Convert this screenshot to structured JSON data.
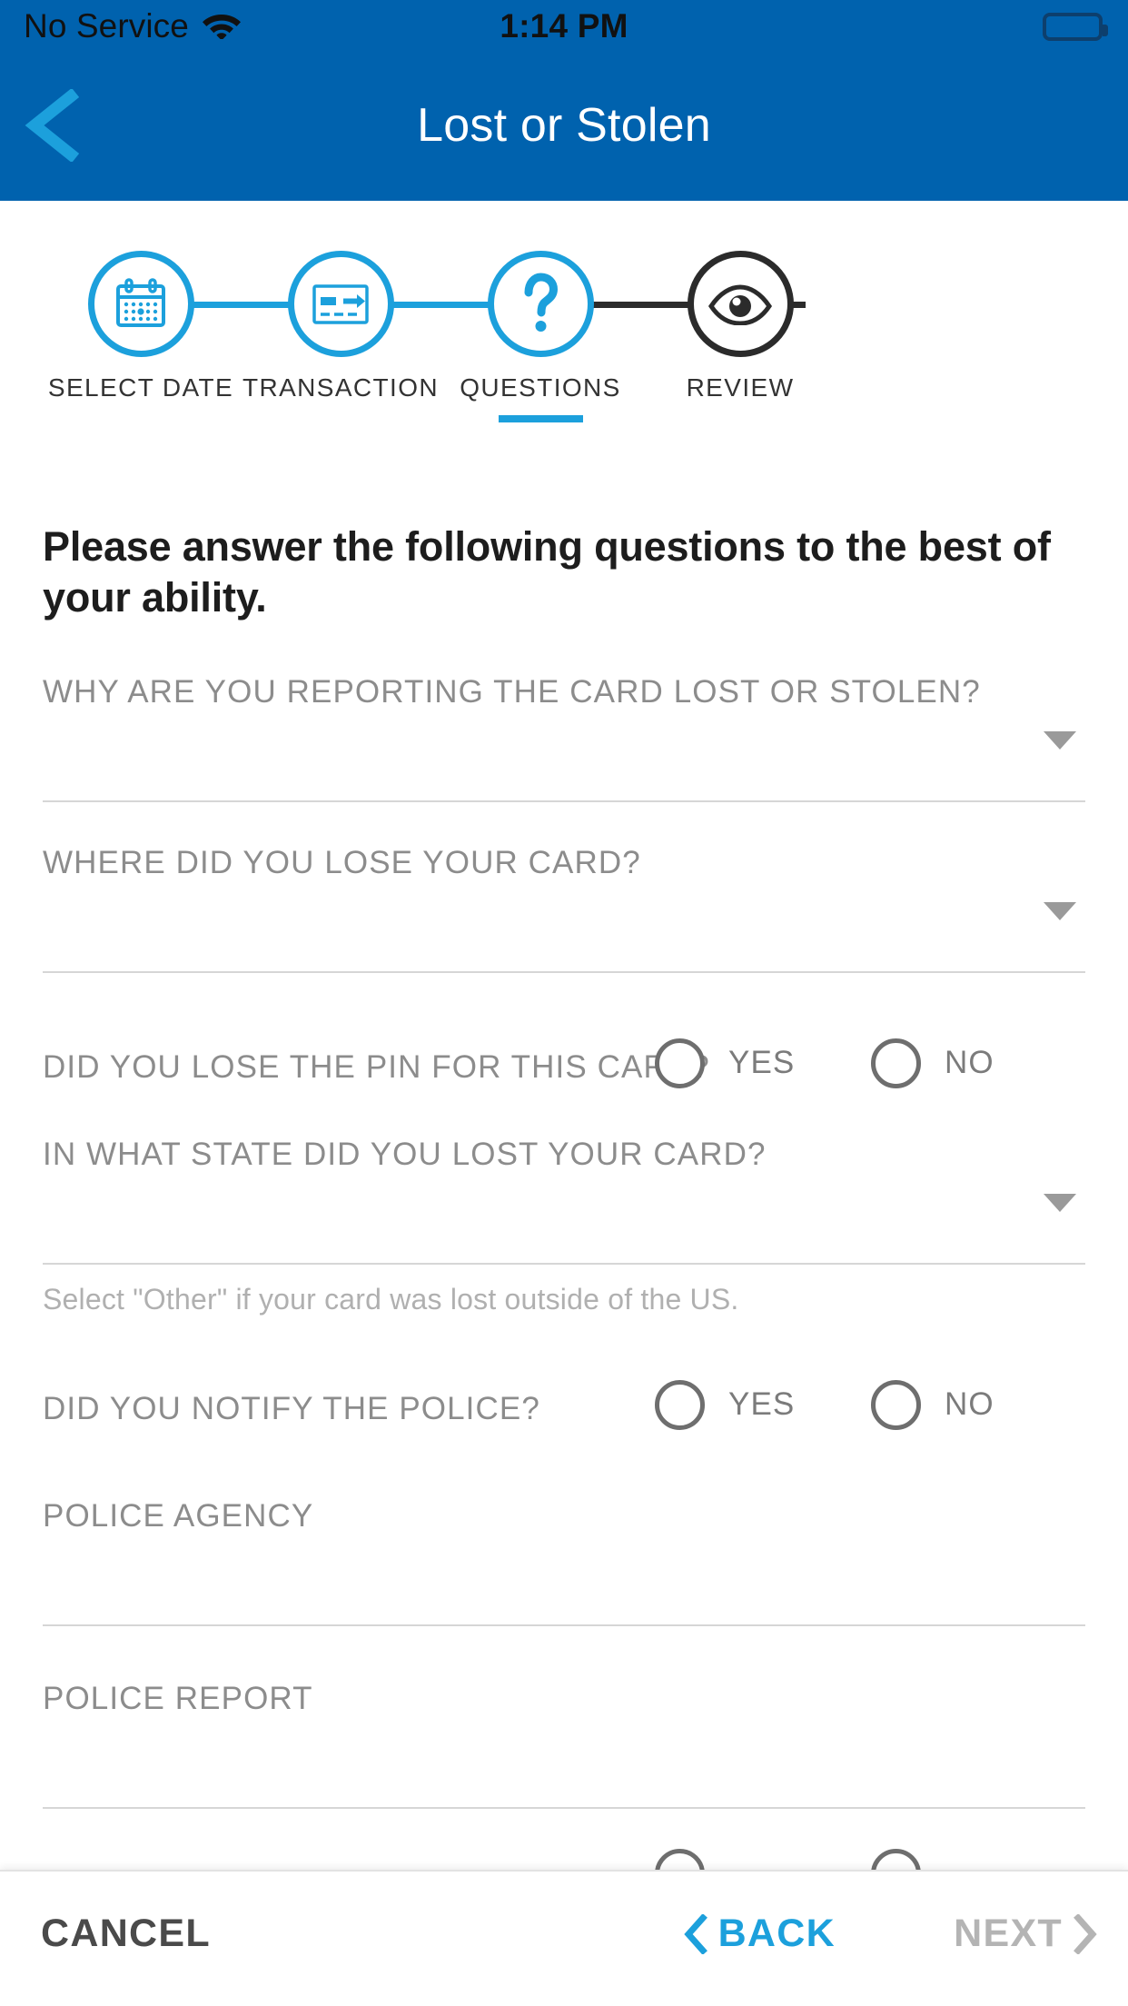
{
  "status_bar": {
    "carrier": "No Service",
    "wifi_icon": "wifi-icon",
    "time": "1:14 PM",
    "battery_icon": "battery-full-icon"
  },
  "nav": {
    "back_icon": "chevron-left-icon",
    "title": "Lost or Stolen"
  },
  "colors": {
    "header_blue": "#0062AE",
    "accent_blue": "#1CA0DC",
    "inactive_dark": "#2B2B2B",
    "label_gray": "#8C8C8C",
    "line_gray": "#D6D6D6",
    "helper_gray": "#B0B0B0",
    "disabled_gray": "#B4B4B4"
  },
  "stepper": {
    "steps": [
      {
        "label": "SELECT DATE",
        "icon": "calendar-icon",
        "state": "complete"
      },
      {
        "label": "TRANSACTION",
        "icon": "card-transfer-icon",
        "state": "complete"
      },
      {
        "label": "QUESTIONS",
        "icon": "question-mark-icon",
        "state": "active"
      },
      {
        "label": "REVIEW",
        "icon": "eye-icon",
        "state": "inactive"
      }
    ]
  },
  "main": {
    "heading": "Please answer the following questions to the best of your ability.",
    "fields": [
      {
        "label": "WHY ARE YOU REPORTING THE CARD LOST OR STOLEN?",
        "type": "dropdown",
        "value": ""
      },
      {
        "label": "WHERE DID YOU LOSE YOUR CARD?",
        "type": "dropdown",
        "value": ""
      },
      {
        "label": "DID YOU LOSE THE PIN FOR THIS CARD?",
        "type": "radio",
        "options": [
          "YES",
          "NO"
        ],
        "selected": ""
      },
      {
        "label": "IN WHAT STATE DID YOU LOST YOUR CARD?",
        "type": "dropdown",
        "value": "",
        "helper": "Select \"Other\" if your card was lost outside of the US."
      },
      {
        "label": "DID YOU NOTIFY THE POLICE?",
        "type": "radio",
        "options": [
          "YES",
          "NO"
        ],
        "selected": ""
      },
      {
        "label": "POLICE AGENCY",
        "type": "text",
        "value": ""
      },
      {
        "label": "POLICE REPORT",
        "type": "text",
        "value": ""
      }
    ]
  },
  "footer": {
    "cancel_label": "CANCEL",
    "back_label": "BACK",
    "back_icon": "chevron-left-icon",
    "next_label": "NEXT",
    "next_icon": "chevron-right-icon",
    "next_disabled": true
  }
}
